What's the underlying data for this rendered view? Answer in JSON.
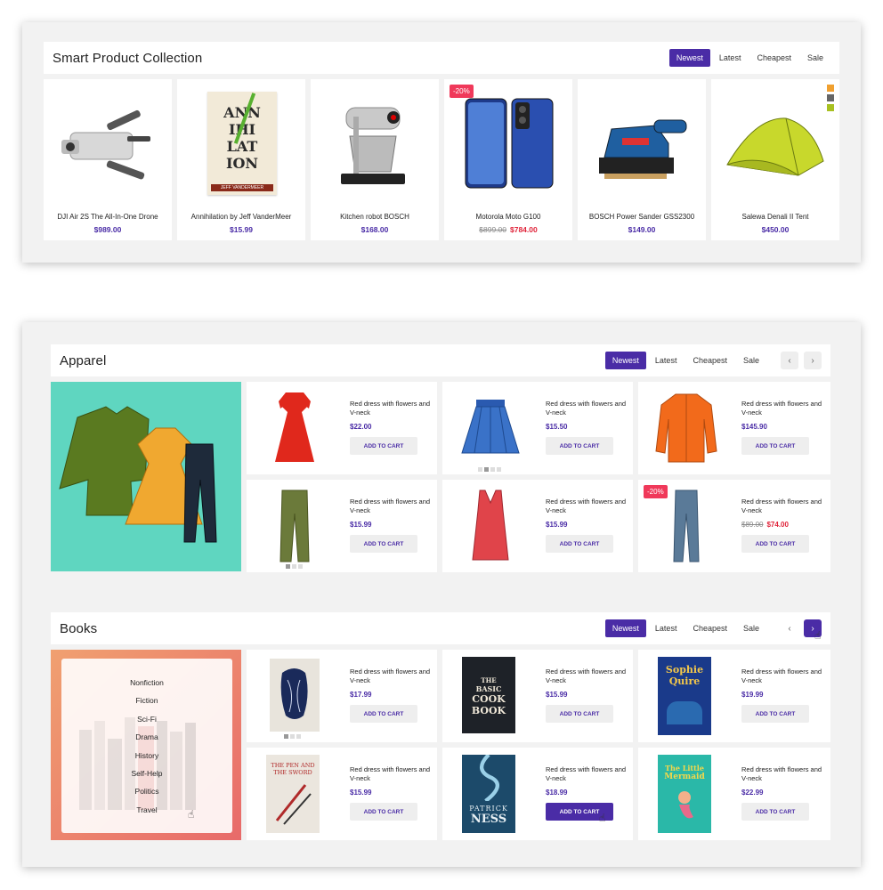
{
  "collection": {
    "title": "Smart Product Collection",
    "tabs": [
      "Newest",
      "Latest",
      "Cheapest",
      "Sale"
    ],
    "products": [
      {
        "name": "DJI Air 2S The All-In-One Drone",
        "price": "$989.00"
      },
      {
        "name": "Annihilation by Jeff VanderMeer",
        "price": "$15.99",
        "cover_lines": [
          "ANN",
          "IHI",
          "LAT",
          "ION"
        ],
        "author": "JEFF VANDERMEER"
      },
      {
        "name": "Kitchen robot BOSCH",
        "price": "$168.00"
      },
      {
        "name": "Motorola Moto G100",
        "old_price": "$899.00",
        "price": "$784.00",
        "badge": "-20%"
      },
      {
        "name": "BOSCH Power Sander GSS2300",
        "price": "$149.00"
      },
      {
        "name": "Salewa Denali II Tent",
        "price": "$450.00",
        "swatch_colors": [
          "#f0a030",
          "#666666",
          "#a8c020"
        ]
      }
    ]
  },
  "apparel": {
    "title": "Apparel",
    "tabs": [
      "Newest",
      "Latest",
      "Cheapest",
      "Sale"
    ],
    "prev": "‹",
    "next": "›",
    "items": [
      {
        "name": "Red dress with flowers and V-neck",
        "price": "$22.00",
        "cart": "ADD TO CART"
      },
      {
        "name": "Red dress with flowers and V-neck",
        "price": "$15.50",
        "cart": "ADD TO CART"
      },
      {
        "name": "Red dress with flowers and V-neck",
        "price": "$145.90",
        "cart": "ADD TO CART"
      },
      {
        "name": "Red dress with flowers and V-neck",
        "price": "$15.99",
        "cart": "ADD TO CART"
      },
      {
        "name": "Red dress with flowers and V-neck",
        "price": "$15.99",
        "cart": "ADD TO CART"
      },
      {
        "name": "Red dress with flowers and V-neck",
        "old_price": "$89.00",
        "price": "$74.00",
        "cart": "ADD TO CART",
        "badge": "-20%"
      }
    ]
  },
  "books": {
    "title": "Books",
    "tabs": [
      "Newest",
      "Latest",
      "Cheapest",
      "Sale"
    ],
    "prev": "‹",
    "next": "›",
    "categories": [
      "Nonfiction",
      "Fiction",
      "Sci-Fi",
      "Drama",
      "History",
      "Self-Help",
      "Politics",
      "Travel"
    ],
    "items": [
      {
        "name": "Red dress with flowers and V-neck",
        "price": "$17.99",
        "cart": "ADD TO CART"
      },
      {
        "name": "Red dress with flowers and V-neck",
        "price": "$15.99",
        "cart": "ADD TO CART",
        "cover_lines": [
          "THE",
          "BASIC",
          "COOK",
          "BOOK"
        ]
      },
      {
        "name": "Red dress with flowers and V-neck",
        "price": "$19.99",
        "cart": "ADD TO CART",
        "cover_lines": [
          "Sophie",
          "Quire"
        ]
      },
      {
        "name": "Red dress with flowers and V-neck",
        "price": "$15.99",
        "cart": "ADD TO CART",
        "cover_lines": [
          "THE PEN AND",
          "THE SWORD"
        ]
      },
      {
        "name": "Red dress with flowers and V-neck",
        "price": "$18.99",
        "cart": "ADD TO CART",
        "cover_lines": [
          "PATRICK",
          "NESS"
        ]
      },
      {
        "name": "Red dress with flowers and V-neck",
        "price": "$22.99",
        "cart": "ADD TO CART",
        "cover_lines": [
          "The Little",
          "Mermaid"
        ]
      }
    ]
  },
  "colors": {
    "accent": "#4a2ca6",
    "sale": "#f0395a",
    "apparel_banner": "#5fd6c0"
  }
}
